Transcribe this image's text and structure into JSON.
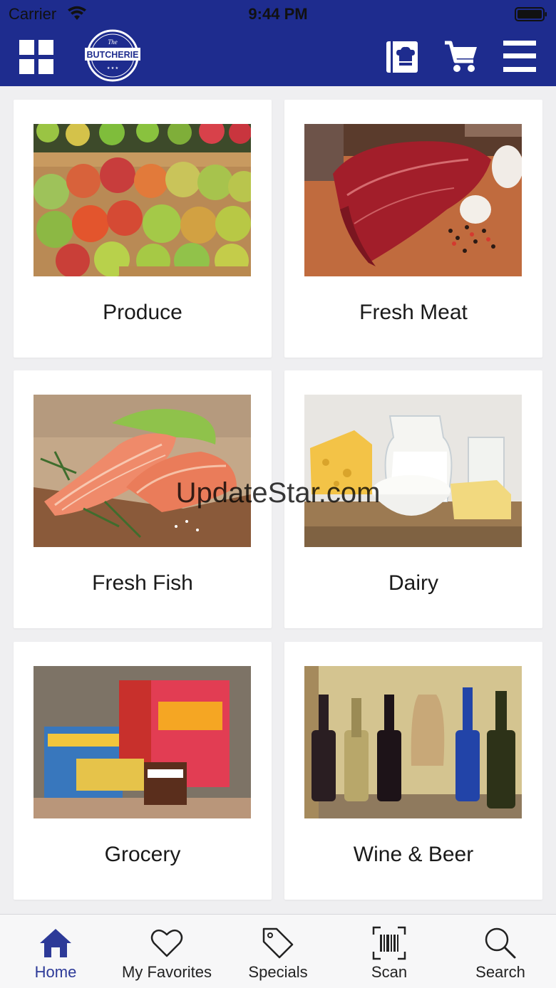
{
  "status_bar": {
    "carrier": "Carrier",
    "time": "9:44 PM"
  },
  "header": {
    "logo_text": "BUTCHERIE",
    "logo_small": "The",
    "brand_color": "#1e2c8e",
    "icons": [
      "grid-icon",
      "recipe-icon",
      "cart-icon",
      "menu-icon"
    ]
  },
  "categories": [
    {
      "label": "Produce"
    },
    {
      "label": "Fresh Meat"
    },
    {
      "label": "Fresh Fish"
    },
    {
      "label": "Dairy"
    },
    {
      "label": "Grocery"
    },
    {
      "label": "Wine & Beer"
    }
  ],
  "watermark": "UpdateStar.com",
  "tabbar": {
    "active_color": "#2d3a98",
    "tabs": [
      {
        "label": "Home",
        "icon": "home-icon"
      },
      {
        "label": "My Favorites",
        "icon": "heart-icon"
      },
      {
        "label": "Specials",
        "icon": "tag-icon"
      },
      {
        "label": "Scan",
        "icon": "barcode-icon"
      },
      {
        "label": "Search",
        "icon": "search-icon"
      }
    ]
  }
}
